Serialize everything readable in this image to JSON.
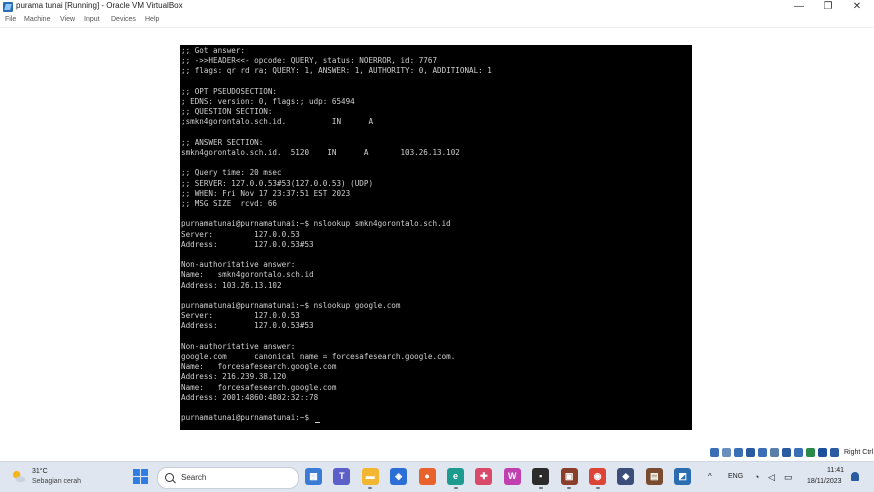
{
  "window": {
    "title": "purama tunai [Running] - Oracle VM VirtualBox",
    "controls": [
      "—",
      "❐",
      "✕"
    ]
  },
  "menubar": {
    "items": [
      "File",
      "Machine",
      "View",
      "Input",
      "Devices",
      "Help"
    ]
  },
  "terminal": {
    "lines": [
      ";; Got answer:",
      ";; ->>HEADER<<- opcode: QUERY, status: NOERROR, id: 7767",
      ";; flags: qr rd ra; QUERY: 1, ANSWER: 1, AUTHORITY: 0, ADDITIONAL: 1",
      "",
      ";; OPT PSEUDOSECTION:",
      "; EDNS: version: 0, flags:; udp: 65494",
      ";; QUESTION SECTION:",
      ";smkn4gorontalo.sch.id.          IN      A",
      "",
      ";; ANSWER SECTION:",
      "smkn4gorontalo.sch.id.  5120    IN      A       103.26.13.102",
      "",
      ";; Query time: 20 msec",
      ";; SERVER: 127.0.0.53#53(127.0.0.53) (UDP)",
      ";; WHEN: Fri Nov 17 23:37:51 EST 2023",
      ";; MSG SIZE  rcvd: 66",
      "",
      "purnamatunai@purnamatunai:~$ nslookup smkn4gorontalo.sch.id",
      "Server:         127.0.0.53",
      "Address:        127.0.0.53#53",
      "",
      "Non-authoritative answer:",
      "Name:   smkn4gorontalo.sch.id",
      "Address: 103.26.13.102",
      "",
      "purnamatunai@purnamatunai:~$ nslookup google.com",
      "Server:         127.0.0.53",
      "Address:        127.0.0.53#53",
      "",
      "Non-authoritative answer:",
      "google.com      canonical name = forcesafesearch.google.com.",
      "Name:   forcesafesearch.google.com",
      "Address: 216.239.38.120",
      "Name:   forcesafesearch.google.com",
      "Address: 2001:4860:4802:32::78",
      "",
      "purnamatunai@purnamatunai:~$ "
    ]
  },
  "vm_status": {
    "host_key": "Right Ctrl",
    "icons": [
      "storage-icon",
      "optical-icon",
      "audio-icon",
      "network-icon",
      "usb-icon",
      "shared-folder-icon",
      "display-icon",
      "capture-icon",
      "cpu-icon",
      "mouse-icon",
      "keyboard-icon"
    ]
  },
  "taskbar": {
    "weather": {
      "temp": "31°C",
      "desc": "Sebagian cerah"
    },
    "search_placeholder": "Search",
    "apps": [
      {
        "name": "widgets-app",
        "color": "#3a7bd5",
        "glyph": "▦"
      },
      {
        "name": "teams-app",
        "color": "#5b5fc7",
        "glyph": "T"
      },
      {
        "name": "file-explorer-app",
        "color": "#f2b630",
        "glyph": "▬"
      },
      {
        "name": "store-app",
        "color": "#2b6fd6",
        "glyph": "◈"
      },
      {
        "name": "firefox-app",
        "color": "#e8622c",
        "glyph": "●"
      },
      {
        "name": "edge-app",
        "color": "#1d9b8e",
        "glyph": "e"
      },
      {
        "name": "app-7",
        "color": "#d94a6a",
        "glyph": "✚"
      },
      {
        "name": "app-8",
        "color": "#c23fb0",
        "glyph": "W"
      },
      {
        "name": "terminal-app",
        "color": "#2b2b2b",
        "glyph": "▪"
      },
      {
        "name": "app-10",
        "color": "#8a3f2c",
        "glyph": "▣"
      },
      {
        "name": "chrome-app",
        "color": "#db4437",
        "glyph": "◉"
      },
      {
        "name": "virtualbox-app",
        "color": "#3b4e7a",
        "glyph": "◆"
      },
      {
        "name": "app-13",
        "color": "#7a4b2e",
        "glyph": "▤"
      },
      {
        "name": "app-14",
        "color": "#2c6cb0",
        "glyph": "◩"
      }
    ],
    "tray": {
      "chevron": "^",
      "lang": "ENG",
      "time": "11:41",
      "date": "18/11/2023"
    }
  }
}
